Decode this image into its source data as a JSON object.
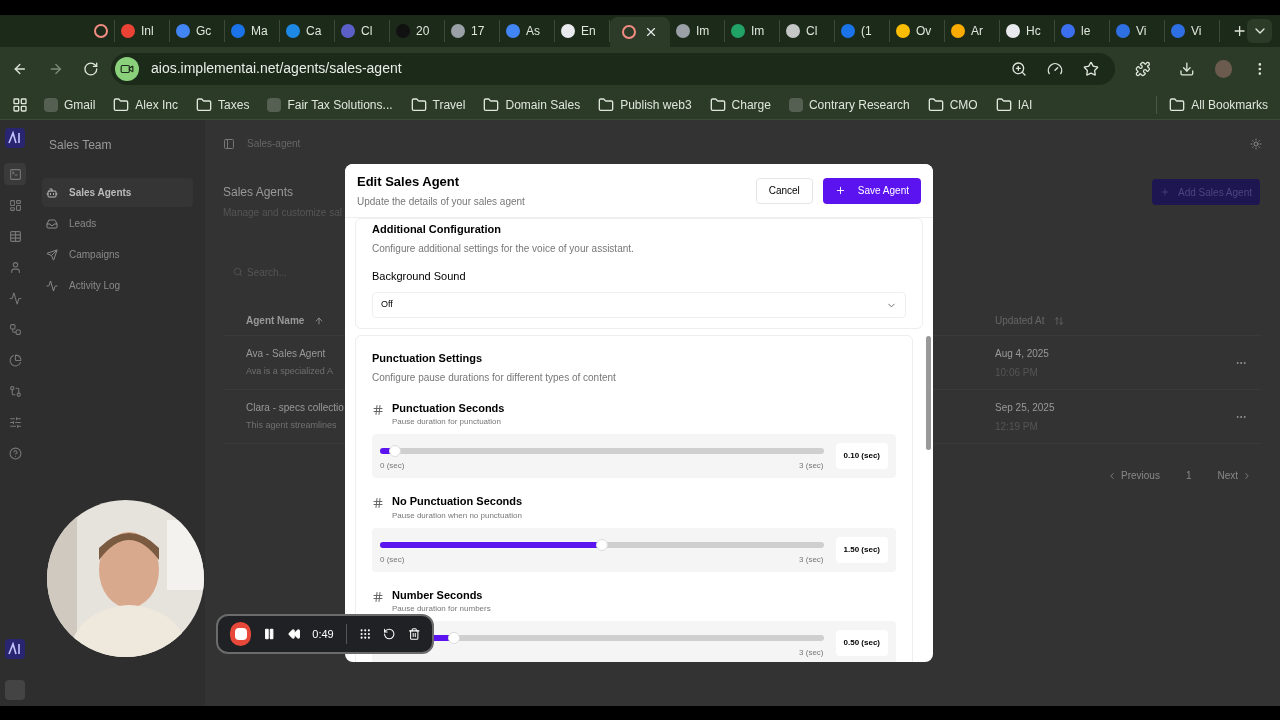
{
  "browser": {
    "tabs": [
      {
        "color": "#f28b82",
        "selected": false
      },
      {
        "label": "Inl",
        "color": "#ea4335",
        "selected": false
      },
      {
        "label": "Gc",
        "color": "#4285f4",
        "selected": false
      },
      {
        "label": "Ma",
        "color": "#1a73e8",
        "selected": false
      },
      {
        "label": "Ca",
        "color": "#1e88e5",
        "selected": false
      },
      {
        "label": "Cl",
        "color": "#5b5fc7",
        "selected": false
      },
      {
        "label": "20",
        "color": "#111111",
        "selected": false
      },
      {
        "label": "17",
        "color": "#9aa0a6",
        "selected": false
      },
      {
        "label": "As",
        "color": "#4285f4",
        "selected": false
      },
      {
        "label": "En",
        "color": "#e8eaed",
        "selected": false
      },
      {
        "color": "#f28b82",
        "selected": true
      },
      {
        "label": "Im",
        "color": "#9aa0a6",
        "selected": false
      },
      {
        "label": "Im",
        "color": "#21a366",
        "selected": false
      },
      {
        "label": "Cl",
        "color": "#c4c7c5",
        "selected": false
      },
      {
        "label": "(1",
        "color": "#1a73e8",
        "selected": false
      },
      {
        "label": "Ov",
        "color": "#fbbc04",
        "selected": false
      },
      {
        "label": "Ar",
        "color": "#f9ab00",
        "selected": false
      },
      {
        "label": "Hc",
        "color": "#e8eaed",
        "selected": false
      },
      {
        "label": "le",
        "color": "#3b6ff0",
        "selected": false
      },
      {
        "label": "Vi",
        "color": "#2f6fe4",
        "selected": false
      },
      {
        "label": "Vi",
        "color": "#2f6fe4",
        "selected": false
      }
    ],
    "url": "aios.implementai.net/agents/sales-agent",
    "bookmarks": [
      {
        "label": "Gmail",
        "kind": "site"
      },
      {
        "label": "Alex Inc",
        "kind": "folder"
      },
      {
        "label": "Taxes",
        "kind": "folder"
      },
      {
        "label": "Fair Tax Solutions...",
        "kind": "site"
      },
      {
        "label": "Travel",
        "kind": "folder"
      },
      {
        "label": "Domain Sales",
        "kind": "folder"
      },
      {
        "label": "Publish web3",
        "kind": "folder"
      },
      {
        "label": "Charge",
        "kind": "folder"
      },
      {
        "label": "Contrary Research",
        "kind": "site"
      },
      {
        "label": "CMO",
        "kind": "folder"
      },
      {
        "label": "IAI",
        "kind": "folder"
      }
    ],
    "all_bookmarks": "All Bookmarks"
  },
  "rail": [
    {
      "selected": true
    },
    {
      "selected": false
    },
    {
      "selected": false
    },
    {
      "selected": false
    },
    {
      "selected": false
    },
    {
      "selected": false
    },
    {
      "selected": false
    },
    {
      "selected": false
    },
    {
      "selected": false
    },
    {
      "selected": false
    }
  ],
  "sidebar": {
    "title": "Sales Team",
    "items": [
      {
        "label": "Sales Agents",
        "selected": true
      },
      {
        "label": "Leads",
        "selected": false
      },
      {
        "label": "Campaigns",
        "selected": false
      },
      {
        "label": "Activity Log",
        "selected": false
      }
    ]
  },
  "main": {
    "breadcrumb": "Sales-agent",
    "title": "Sales Agents",
    "subtitle": "Manage and customize sal",
    "add_button": "Add Sales Agent",
    "search": {
      "placeholder": "Search..."
    },
    "table": {
      "columns": [
        "Agent Name",
        "Updated At"
      ],
      "rows": [
        {
          "name": "Ava - Sales Agent",
          "description": "Ava is a specialized A",
          "date": "Aug 4, 2025",
          "time": "10:06 PM"
        },
        {
          "name": "Clara - specs collectio",
          "description": "This agent streamlines",
          "date": "Sep 25, 2025",
          "time": "12:19 PM"
        }
      ]
    },
    "pagination": {
      "previous": "Previous",
      "page": "1",
      "next": "Next"
    }
  },
  "modal": {
    "title": "Edit Sales Agent",
    "subtitle": "Update the details of your sales agent",
    "cancel": "Cancel",
    "save": "Save Agent",
    "additional": {
      "title": "Additional Configuration",
      "description": "Configure additional settings for the voice of your assistant.",
      "field_label": "Background Sound",
      "value": "Off"
    },
    "punctuation": {
      "title": "Punctuation Settings",
      "description": "Configure pause durations for different types of content",
      "sliders": [
        {
          "title": "Punctuation Seconds",
          "hint": "Pause duration for punctuation",
          "level": 0.033,
          "min": "0 (sec)",
          "max": "3 (sec)",
          "value": "0.10 (sec)"
        },
        {
          "title": "No Punctuation Seconds",
          "hint": "Pause duration when no punctuation",
          "level": 0.5,
          "min": "0 (sec)",
          "max": "3 (sec)",
          "value": "1.50 (sec)"
        },
        {
          "title": "Number Seconds",
          "hint": "Pause duration for numbers",
          "level": 0.167,
          "max": "3 (sec)",
          "value": "0.50 (sec)"
        }
      ]
    }
  },
  "recorder": {
    "time": "0:49"
  }
}
